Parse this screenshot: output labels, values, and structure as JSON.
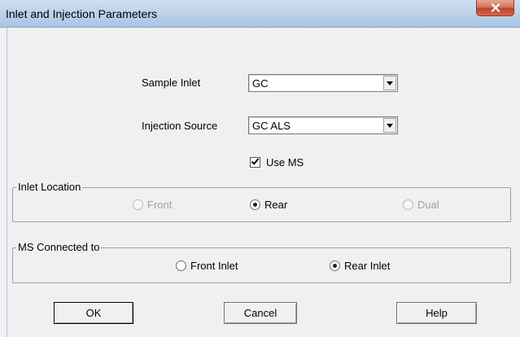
{
  "window": {
    "title": "Inlet and Injection Parameters",
    "close_label": "X"
  },
  "form": {
    "sample_inlet": {
      "label": "Sample Inlet",
      "value": "GC"
    },
    "injection_source": {
      "label": "Injection Source",
      "value": "GC ALS"
    },
    "use_ms": {
      "label": "Use MS",
      "checked": true
    }
  },
  "inlet_location": {
    "title": "Inlet Location",
    "options": [
      {
        "label": "Front",
        "selected": false,
        "enabled": false
      },
      {
        "label": "Rear",
        "selected": true,
        "enabled": true
      },
      {
        "label": "Dual",
        "selected": false,
        "enabled": false
      }
    ]
  },
  "ms_connected": {
    "title": "MS Connected to",
    "options": [
      {
        "label": "Front Inlet",
        "selected": false,
        "enabled": true
      },
      {
        "label": "Rear Inlet",
        "selected": true,
        "enabled": true
      }
    ]
  },
  "buttons": {
    "ok": "OK",
    "cancel": "Cancel",
    "help": "Help"
  }
}
